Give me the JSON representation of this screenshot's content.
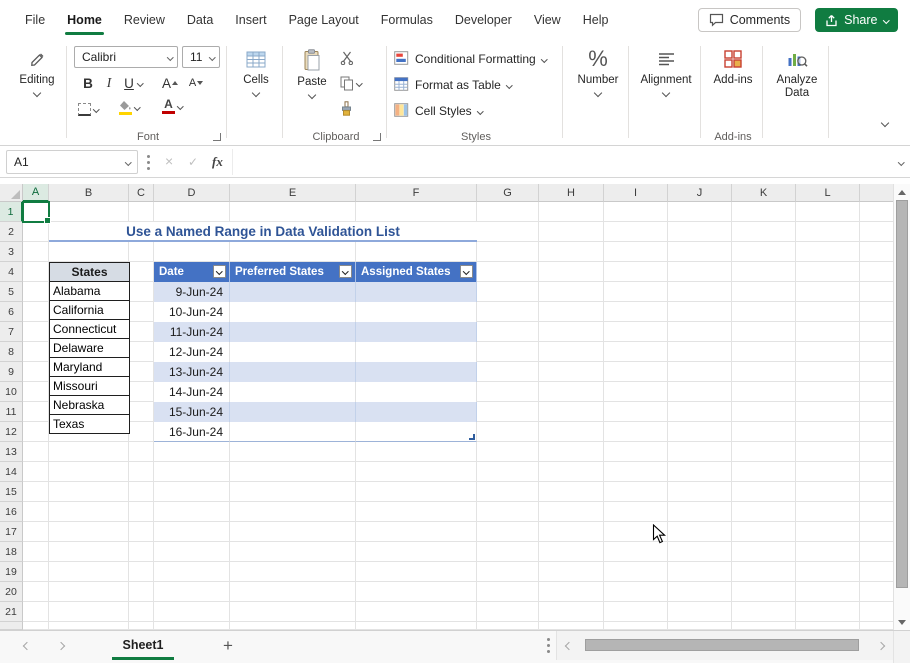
{
  "colors": {
    "accent_green": "#107C41",
    "table_header_blue": "#4472C4",
    "table_band_blue": "#D9E1F2",
    "title_blue": "#2F5496",
    "title_underline": "#8EA9DB",
    "states_header_fill": "#D6DCE4"
  },
  "tabs": {
    "items": [
      {
        "label": "File",
        "active": false
      },
      {
        "label": "Home",
        "active": true
      },
      {
        "label": "Review",
        "active": false
      },
      {
        "label": "Data",
        "active": false
      },
      {
        "label": "Insert",
        "active": false
      },
      {
        "label": "Page Layout",
        "active": false
      },
      {
        "label": "Formulas",
        "active": false
      },
      {
        "label": "Developer",
        "active": false
      },
      {
        "label": "View",
        "active": false
      },
      {
        "label": "Help",
        "active": false
      }
    ],
    "comments_label": "Comments",
    "share_label": "Share"
  },
  "ribbon": {
    "editing_label": "Editing",
    "font_name_value": "Calibri",
    "font_size_value": "11",
    "bold_label": "B",
    "italic_label": "I",
    "underline_label": "U",
    "grow_font_label": "A",
    "shrink_font_label": "A",
    "font_color_label": "A",
    "font_group_label": "Font",
    "cells_label": "Cells",
    "paste_label": "Paste",
    "clipboard_group_label": "Clipboard",
    "conditional_formatting_label": "Conditional Formatting",
    "format_as_table_label": "Format as Table",
    "cell_styles_label": "Cell Styles",
    "styles_group_label": "Styles",
    "number_label": "Number",
    "percent_glyph": "%",
    "alignment_label": "Alignment",
    "addins_button_label": "Add-ins",
    "addins_group_label": "Add-ins",
    "analyze_data_label": "Analyze Data"
  },
  "formula_bar": {
    "name_box_value": "A1",
    "cancel_glyph": "×",
    "confirm_glyph": "✓",
    "fx_label": "fx",
    "formula_value": ""
  },
  "sheet": {
    "column_headers": [
      "A",
      "B",
      "C",
      "D",
      "E",
      "F",
      "G",
      "H",
      "I",
      "J",
      "K",
      "L"
    ],
    "row_headers": [
      "1",
      "2",
      "3",
      "4",
      "5",
      "6",
      "7",
      "8",
      "9",
      "10",
      "11",
      "12",
      "13",
      "14",
      "15",
      "16",
      "17",
      "18",
      "19",
      "20",
      "21"
    ],
    "title": "Use a Named Range in Data Validation List",
    "states_list": {
      "header": "States",
      "items": [
        "Alabama",
        "California",
        "Connecticut",
        "Delaware",
        "Maryland",
        "Missouri",
        "Nebraska",
        "Texas"
      ]
    },
    "table": {
      "headers": [
        "Date",
        "Preferred States",
        "Assigned States"
      ],
      "dates": [
        "9-Jun-24",
        "10-Jun-24",
        "11-Jun-24",
        "12-Jun-24",
        "13-Jun-24",
        "14-Jun-24",
        "15-Jun-24",
        "16-Jun-24"
      ]
    }
  },
  "sheet_bar": {
    "active_sheet": "Sheet1",
    "new_sheet_label": "+"
  }
}
